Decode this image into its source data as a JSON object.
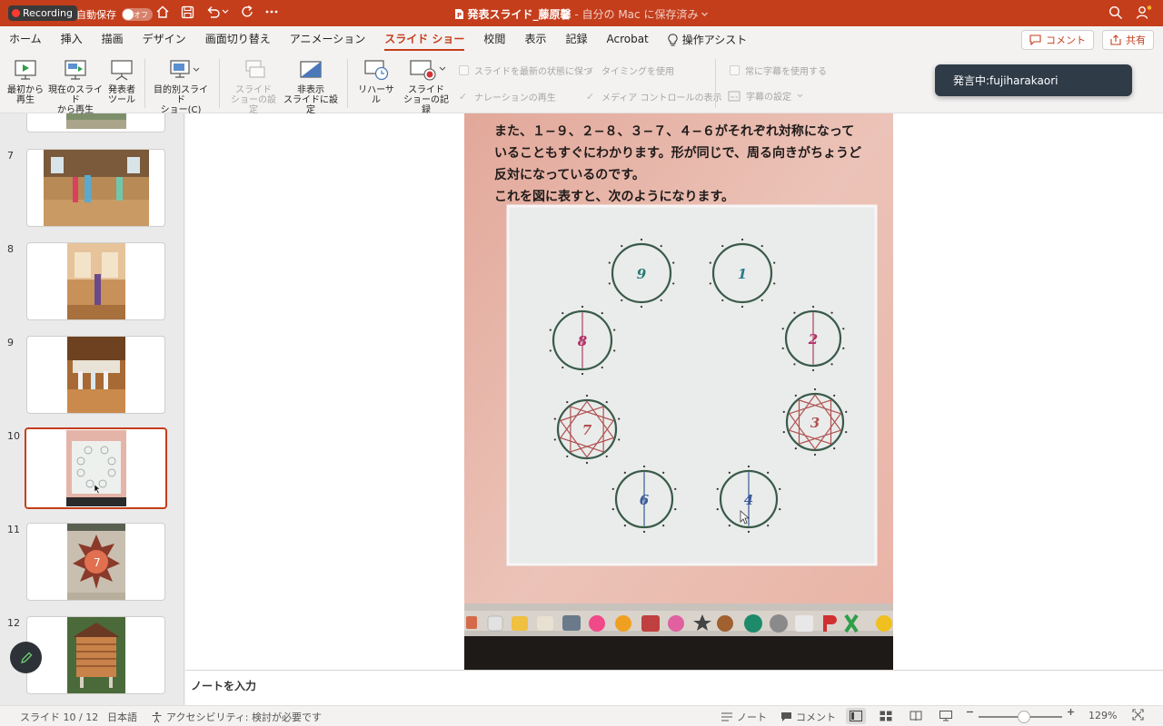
{
  "titlebar": {
    "recording": "Recording",
    "autosave_label": "自動保存",
    "autosave_state": "オフ",
    "doc_name": "発表スライド_藤原馨",
    "doc_location": " - 自分の Mac に保存済み",
    "accent": "#c43e1c"
  },
  "tabs": {
    "items": [
      "ホーム",
      "挿入",
      "描画",
      "デザイン",
      "画面切り替え",
      "アニメーション",
      "スライド ショー",
      "校閲",
      "表示",
      "記録",
      "Acrobat"
    ],
    "active_index": 6,
    "assist": "操作アシスト",
    "comment": "コメント",
    "share": "共有"
  },
  "ribbon": {
    "from_start": [
      "最初から",
      "再生"
    ],
    "from_current": [
      "現在のスライド",
      "から再生"
    ],
    "presenter": [
      "発表者",
      "ツール"
    ],
    "custom": [
      "目的別スライド",
      "ショー(C)"
    ],
    "setup": [
      "スライド",
      "ショーの設定"
    ],
    "hide": [
      "非表示",
      "スライドに設定"
    ],
    "rehearse": "リハーサル",
    "record": [
      "スライド",
      "ショーの記録"
    ],
    "keep_updated": "スライドを最新の状態に保つ",
    "use_timings": "タイミングを使用",
    "play_narration": "ナレーションの再生",
    "show_media": "メディア コントロールの表示",
    "always_subtitles": "常に字幕を使用する",
    "subtitle_settings": "字幕の設定"
  },
  "toast": "発言中:fujiharakaori",
  "thumbnails": {
    "numbers": [
      "7",
      "8",
      "9",
      "10",
      "11",
      "12"
    ],
    "selected": "10"
  },
  "slide": {
    "lines": [
      "また、１−９、２−８、３−７、４−６がそれぞれ対称になって",
      "いることもすぐにわかります。形が同じで、周る向きがちょうど",
      "反対になっているのです。",
      "これを図に表すと、次のようになります。"
    ],
    "figures": [
      "9",
      "1",
      "8",
      "2",
      "7",
      "3",
      "6",
      "4"
    ]
  },
  "notes_placeholder": "ノートを入力",
  "status": {
    "slide": "スライド 10 / 12",
    "language": "日本語",
    "accessibility": "アクセシビリティ: 検討が必要です",
    "notes": "ノート",
    "comments": "コメント",
    "zoom": "129%"
  }
}
